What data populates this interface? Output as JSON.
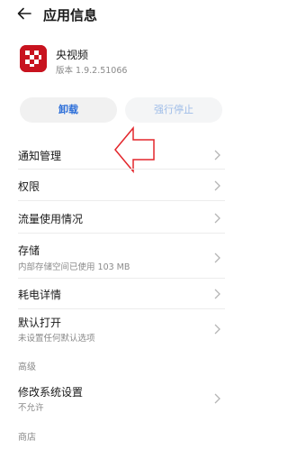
{
  "header": {
    "title": "应用信息",
    "back_icon": "arrow-left-icon"
  },
  "app": {
    "name": "央视频",
    "version": "版本 1.9.2.51066",
    "icon": "app-logo-icon"
  },
  "buttons": {
    "uninstall": "卸载",
    "force_stop": "强行停止"
  },
  "colors": {
    "accent": "#2d6fd9",
    "disabled_text": "#9fbde8",
    "annotation": "#e3262c",
    "logo": "#c8131f"
  },
  "items": {
    "notifications": {
      "label": "通知管理"
    },
    "permissions": {
      "label": "权限"
    },
    "data_usage": {
      "label": "流量使用情况"
    },
    "storage": {
      "label": "存储",
      "sub": "内部存储空间已使用 103 MB"
    },
    "battery": {
      "label": "耗电详情"
    },
    "open_by_default": {
      "label": "默认打开",
      "sub": "未设置任何默认选项"
    },
    "modify_settings": {
      "label": "修改系统设置",
      "sub": "不允许"
    }
  },
  "sections": {
    "advanced": "高级",
    "store": "商店"
  }
}
